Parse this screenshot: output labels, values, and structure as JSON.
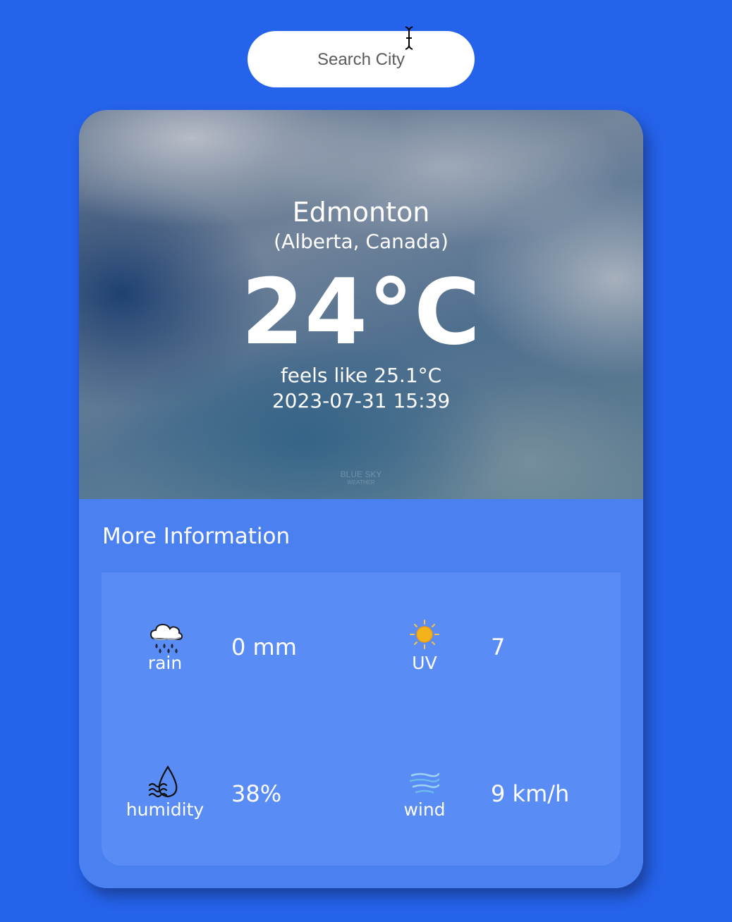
{
  "search": {
    "placeholder": "Search City"
  },
  "location": {
    "city": "Edmonton",
    "region": "(Alberta, Canada)"
  },
  "current": {
    "temperature": "24°C",
    "feels_like": "feels like 25.1°C",
    "datetime": "2023-07-31 15:39"
  },
  "hero_watermark": {
    "line1": "BLUE SKY",
    "line2": "WEATHER"
  },
  "more_info": {
    "title": "More Information",
    "metrics": [
      {
        "label": "rain",
        "value": "0 mm",
        "icon": "rain-cloud-icon"
      },
      {
        "label": "UV",
        "value": "7",
        "icon": "sun-icon"
      },
      {
        "label": "humidity",
        "value": "38%",
        "icon": "water-drop-icon"
      },
      {
        "label": "wind",
        "value": "9 km/h",
        "icon": "wind-icon"
      }
    ]
  },
  "colors": {
    "page_background": "#2563eb",
    "card_lower": "#4b80f0",
    "panel": "#5a8cf5",
    "text": "#ffffff",
    "sun": "#f6b21a"
  }
}
